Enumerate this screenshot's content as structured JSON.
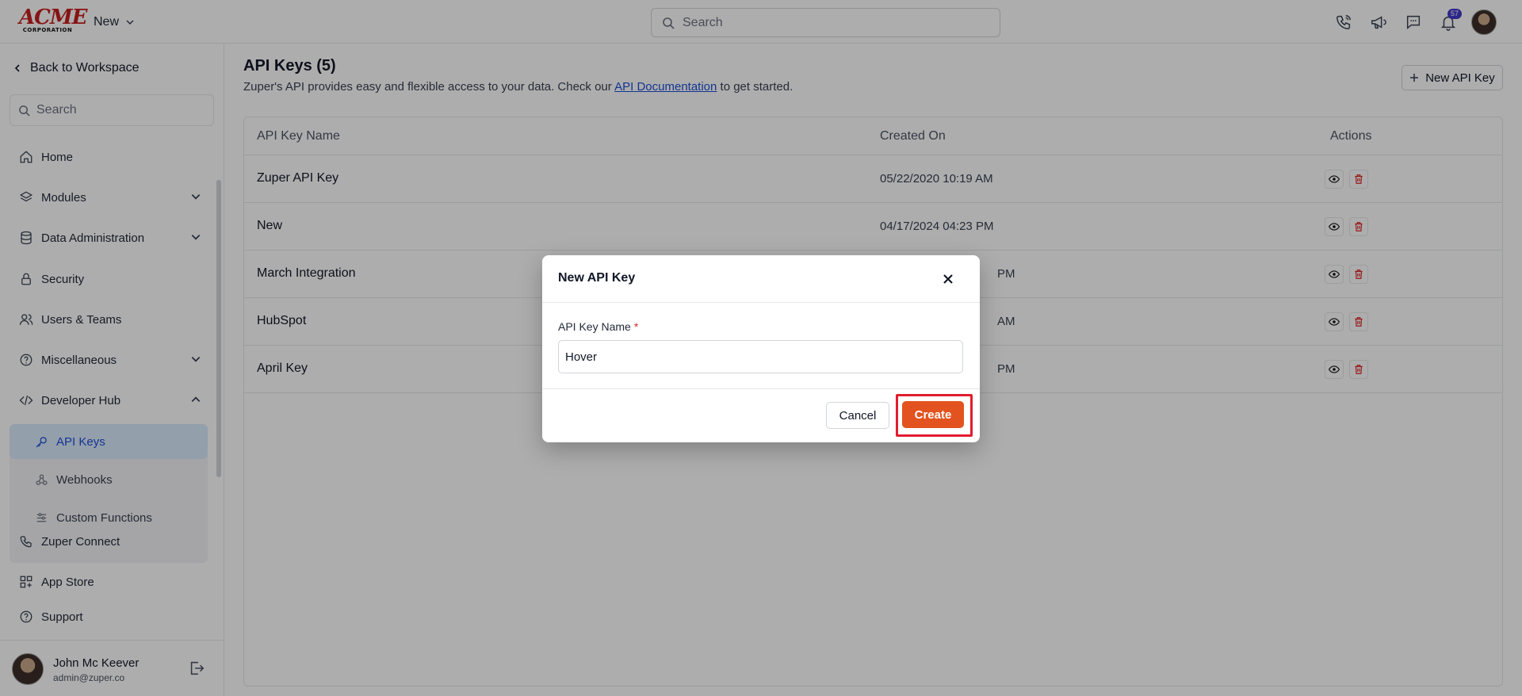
{
  "topbar": {
    "logo_text": "ACME",
    "logo_subtext": "CORPORATION",
    "workspace_label": "New",
    "search_placeholder": "Search",
    "notification_count": "57"
  },
  "sidebar": {
    "back_label": "Back to Workspace",
    "search_placeholder": "Search",
    "items": [
      {
        "label": "Home",
        "icon": "home-icon"
      },
      {
        "label": "Modules",
        "icon": "layers-icon"
      },
      {
        "label": "Data Administration",
        "icon": "database-icon"
      },
      {
        "label": "Security",
        "icon": "lock-icon"
      },
      {
        "label": "Users & Teams",
        "icon": "users-icon"
      },
      {
        "label": "Miscellaneous",
        "icon": "help-circle-icon"
      },
      {
        "label": "Developer Hub",
        "icon": "code-icon"
      }
    ],
    "sub_items": [
      {
        "label": "API Keys",
        "icon": "key-icon"
      },
      {
        "label": "Webhooks",
        "icon": "webhook-icon"
      },
      {
        "label": "Custom Functions",
        "icon": "sliders-icon"
      }
    ],
    "bottom_items": [
      {
        "label": "Zuper Connect",
        "icon": "phone-icon"
      },
      {
        "label": "App Store",
        "icon": "grid-plus-icon"
      },
      {
        "label": "Support",
        "icon": "help-circle-icon"
      }
    ],
    "user": {
      "name": "John Mc Keever",
      "email": "admin@zuper.co"
    }
  },
  "main": {
    "title": "API Keys (5)",
    "desc_before": "Zuper's API provides easy and flexible access to your data. Check our ",
    "desc_link": "API Documentation",
    "desc_after": " to get started.",
    "new_button": "New API Key",
    "columns": [
      "API Key Name",
      "Created On",
      "Actions"
    ],
    "rows": [
      {
        "name": "Zuper API Key",
        "created": "05/22/2020 10:19 AM"
      },
      {
        "name": "New",
        "created": "04/17/2024 04:23 PM"
      },
      {
        "name": "March Integration",
        "created": "PM"
      },
      {
        "name": "HubSpot",
        "created": "AM"
      },
      {
        "name": "April Key",
        "created": "PM"
      }
    ]
  },
  "modal": {
    "title": "New API Key",
    "field_label": "API Key Name",
    "required_mark": "*",
    "field_value": "Hover",
    "cancel_label": "Cancel",
    "create_label": "Create"
  },
  "colors": {
    "accent": "#e2531f",
    "link": "#1d4ed8",
    "highlight": "#e11d2e",
    "delete": "#dc2626"
  }
}
